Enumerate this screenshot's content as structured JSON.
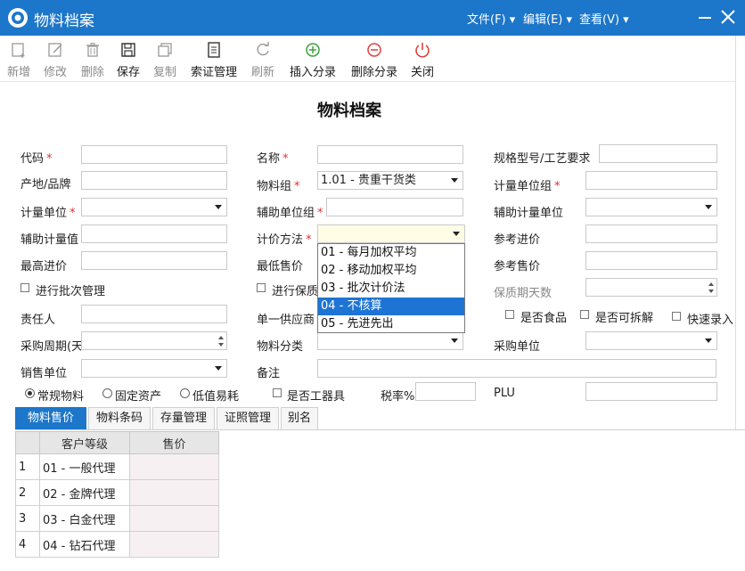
{
  "window": {
    "title": "物料档案",
    "menu": [
      "文件(F)",
      "编辑(E)",
      "查看(V)"
    ]
  },
  "toolbar": {
    "buttons": [
      {
        "label": "新增",
        "icon": "add-doc-icon"
      },
      {
        "label": "修改",
        "icon": "edit-icon"
      },
      {
        "label": "删除",
        "icon": "trash-icon"
      },
      {
        "label": "保存",
        "icon": "save-icon"
      },
      {
        "label": "复制",
        "icon": "copy-icon"
      },
      {
        "label": "索证管理",
        "icon": "doc-list-icon"
      },
      {
        "label": "刷新",
        "icon": "refresh-icon"
      },
      {
        "label": "插入分录",
        "icon": "plus-circle-icon"
      },
      {
        "label": "删除分录",
        "icon": "minus-circle-icon"
      },
      {
        "label": "关闭",
        "icon": "power-icon"
      }
    ]
  },
  "form": {
    "title": "物料档案",
    "labels": {
      "code": "代码",
      "name": "名称",
      "spec": "规格型号/工艺要求",
      "origin": "产地/品牌",
      "group": "物料组",
      "unit_group": "计量单位组",
      "unit": "计量单位",
      "aux_unit_group": "辅助单位组",
      "aux_unit": "辅助计量单位",
      "aux_unit_value": "辅助计量值",
      "valuation": "计价方法",
      "ref_purchase": "参考进价",
      "max_purchase": "最高进价",
      "min_sale": "最低售价",
      "ref_sale": "参考售价",
      "batch": "进行批次管理",
      "shelf_mgmt": "进行保质",
      "shelf_days": "保质期天数",
      "owner": "责任人",
      "single_supplier": "单一供应商",
      "is_food": "是否食品",
      "is_split": "是否可拆解",
      "quick_entry": "快速录入",
      "purchase_cycle": "采购周期(天",
      "category": "物料分类",
      "purchase_unit": "采购单位",
      "sale_unit": "销售单位",
      "remark": "备注",
      "radio_normal": "常规物料",
      "radio_fixed": "固定资产",
      "radio_consumable": "低值易耗",
      "is_tool": "是否工器具",
      "tax_rate": "税率%",
      "plu": "PLU"
    },
    "values": {
      "group": "1.01 - 贵重干货类"
    },
    "valuation_options": [
      "01 - 每月加权平均",
      "02 - 移动加权平均",
      "03 - 批次计价法",
      "04 - 不核算",
      "05 - 先进先出"
    ],
    "valuation_selected_index": 3
  },
  "tabs": [
    "物料售价",
    "物料条码",
    "存量管理",
    "证照管理",
    "别名"
  ],
  "grid": {
    "headers": [
      "客户等级",
      "售价"
    ],
    "rows": [
      {
        "num": "1",
        "level": "01 - 一般代理",
        "price": ""
      },
      {
        "num": "2",
        "level": "02 - 金牌代理",
        "price": ""
      },
      {
        "num": "3",
        "level": "03 - 白金代理",
        "price": ""
      },
      {
        "num": "4",
        "level": "04 - 钻石代理",
        "price": ""
      }
    ]
  },
  "colors": {
    "titlebar": "#1c76c9",
    "required": "#d33333",
    "selection": "#1e74d4"
  }
}
